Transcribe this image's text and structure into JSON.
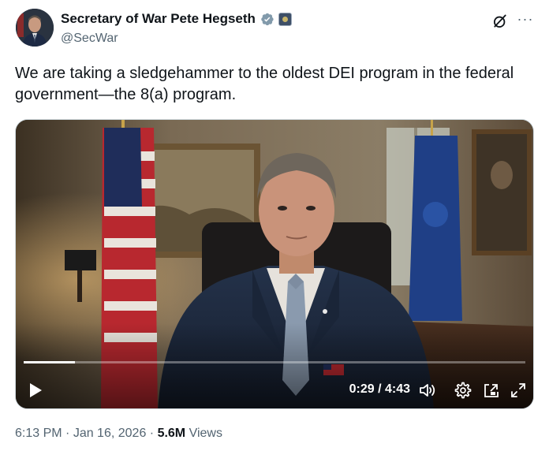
{
  "author": {
    "display_name": "Secretary of War Pete Hegseth",
    "handle": "@SecWar",
    "verified_color": "#829aab"
  },
  "tweet": {
    "text": "We are taking a sledgehammer to the oldest DEI program in the federal\ngovernment—the 8(a) program."
  },
  "video": {
    "elapsed": "0:29",
    "separator": " / ",
    "duration": "4:43",
    "progress_fraction": 0.1025
  },
  "meta": {
    "time": "6:13 PM",
    "dot1": " · ",
    "date": "Jan 16, 2026",
    "dot2": " · ",
    "views_count": "5.6M",
    "views_label": " Views"
  },
  "icons": {
    "grok": "grok-icon",
    "more": "more-icon",
    "play": "play-icon",
    "volume": "volume-icon",
    "settings": "gear-icon",
    "pip": "picture-in-picture-icon",
    "fullscreen": "fullscreen-icon"
  },
  "colors": {
    "text": "#0f1419",
    "secondary": "#536471",
    "border": "#cfd9de"
  }
}
